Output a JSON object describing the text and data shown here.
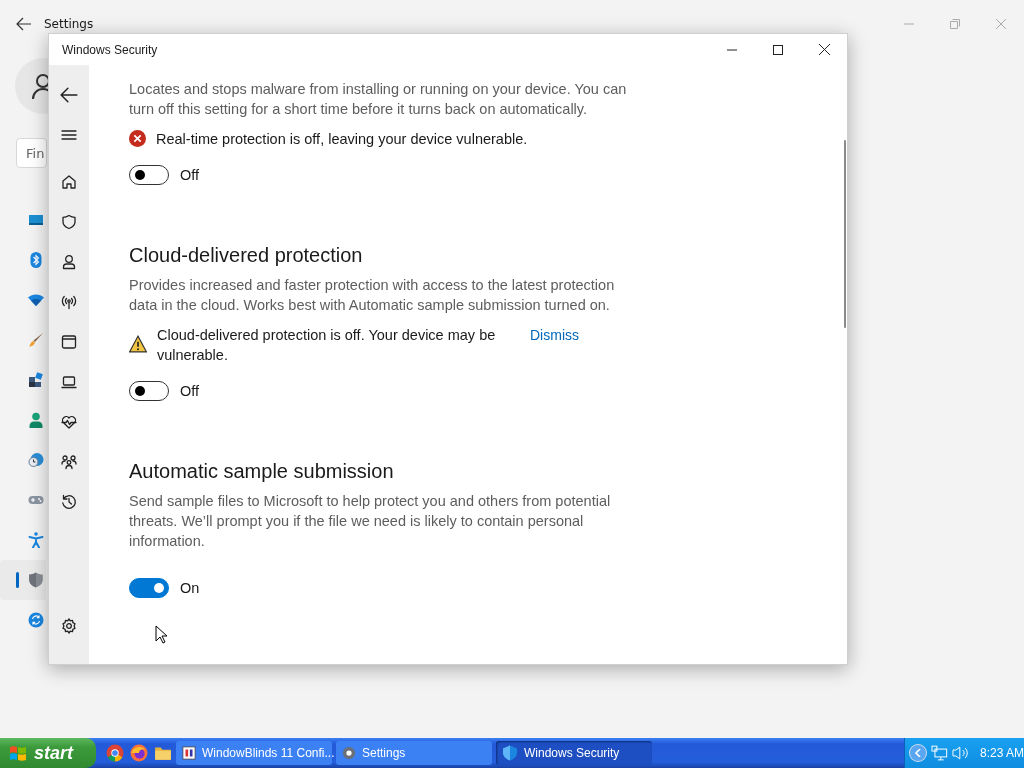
{
  "settings_window": {
    "title": "Settings",
    "search": {
      "placeholder": "Fin"
    },
    "nav": [
      {
        "kind": "display",
        "selected": false
      },
      {
        "kind": "bluetooth",
        "selected": false
      },
      {
        "kind": "wifi",
        "selected": false
      },
      {
        "kind": "brush",
        "selected": false
      },
      {
        "kind": "apps",
        "selected": false
      },
      {
        "kind": "person",
        "selected": false
      },
      {
        "kind": "globe",
        "selected": false
      },
      {
        "kind": "gamepad",
        "selected": false
      },
      {
        "kind": "accessibility",
        "selected": false
      },
      {
        "kind": "shield",
        "selected": true
      },
      {
        "kind": "sync",
        "selected": false
      }
    ]
  },
  "security_window": {
    "title": "Windows Security",
    "nav": [
      {
        "kind": "back"
      },
      {
        "kind": "menu"
      },
      {
        "kind": "home"
      },
      {
        "kind": "shield"
      },
      {
        "kind": "person"
      },
      {
        "kind": "antenna"
      },
      {
        "kind": "window"
      },
      {
        "kind": "laptop"
      },
      {
        "kind": "heart"
      },
      {
        "kind": "family"
      },
      {
        "kind": "history"
      }
    ],
    "nav_bottom": {
      "kind": "settings"
    },
    "sections": [
      {
        "description": "Locates and stops malware from installing or running on your device. You can turn off this setting for a short time before it turns back on automatically.",
        "alert": {
          "kind": "error",
          "text": "Real-time protection is off, leaving your device vulnerable."
        },
        "toggle": {
          "on": false,
          "label": "Off"
        }
      },
      {
        "heading": "Cloud-delivered protection",
        "description": "Provides increased and faster protection with access to the latest protection data in the cloud. Works best with Automatic sample submission turned on.",
        "alert": {
          "kind": "warning",
          "text": "Cloud-delivered protection is off. Your device may be vulnerable.",
          "action": "Dismiss"
        },
        "toggle": {
          "on": false,
          "label": "Off"
        }
      },
      {
        "heading": "Automatic sample submission",
        "description": "Send sample files to Microsoft to help protect you and others from potential threats. We’ll prompt you if the file we need is likely to contain personal information.",
        "toggle": {
          "on": true,
          "label": "On"
        }
      }
    ]
  },
  "taskbar": {
    "start": "start",
    "quick_launch": [
      {
        "kind": "browser"
      },
      {
        "kind": "globe"
      },
      {
        "kind": "folder"
      }
    ],
    "tasks": [
      {
        "kind": "app",
        "label": "WindowBlinds 11 Confi...",
        "selected": false
      },
      {
        "kind": "gear",
        "label": "Settings",
        "selected": false
      },
      {
        "kind": "shield",
        "label": "Windows Security",
        "selected": true
      }
    ],
    "tray": {
      "time": "8:23 AM"
    }
  }
}
